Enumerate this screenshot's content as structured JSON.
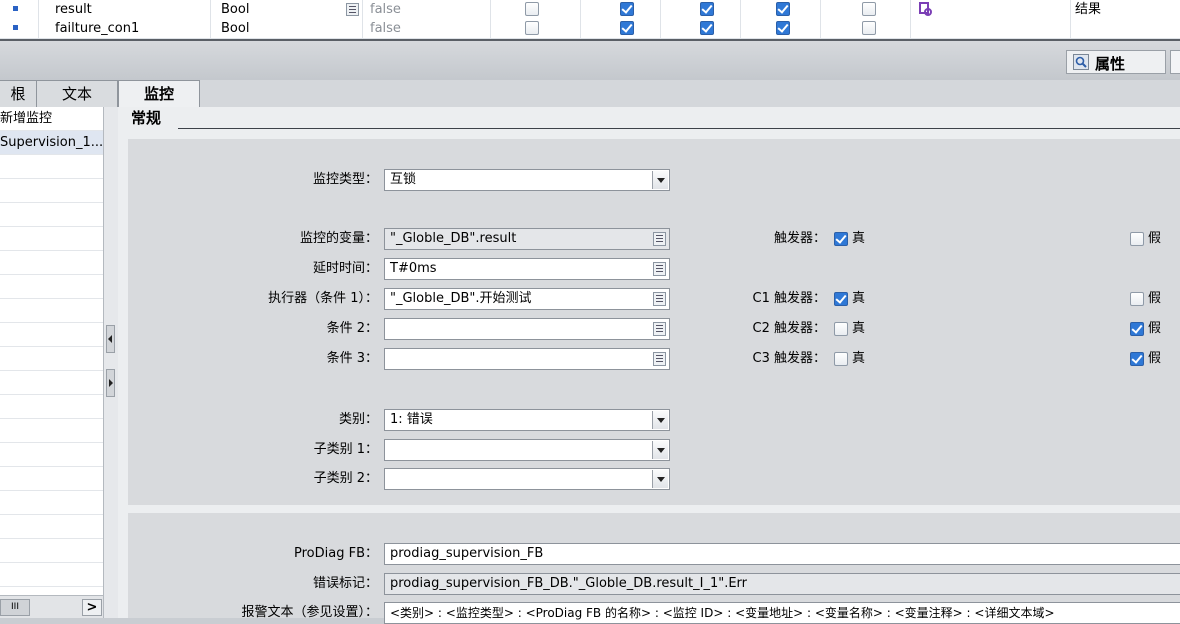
{
  "table": {
    "rows": [
      {
        "name": "result",
        "type": "Bool",
        "value": "false",
        "checks": [
          false,
          true,
          true,
          true,
          false
        ],
        "comment": "结果"
      },
      {
        "name": "failture_con1",
        "type": "Bool",
        "value": "false",
        "checks": [
          false,
          true,
          true,
          true,
          false
        ],
        "comment": ""
      }
    ]
  },
  "header": {
    "properties_label": "属性"
  },
  "tabs": [
    {
      "label": "根"
    },
    {
      "label": "文本"
    },
    {
      "label": "监控"
    }
  ],
  "left_panel": {
    "items": [
      "新增监控",
      "Supervision_1..."
    ]
  },
  "main": {
    "section_title": "常规",
    "supervision_type": {
      "label": "监控类型：",
      "value": "互锁"
    },
    "supervised_tag": {
      "label": "监控的变量：",
      "value": "\"_Globle_DB\".result"
    },
    "delay": {
      "label": "延时时间：",
      "value": "T#0ms"
    },
    "condition1": {
      "label": "执行器（条件 1）：",
      "value": "\"_Globle_DB\".开始测试"
    },
    "condition2": {
      "label": "条件 2：",
      "value": ""
    },
    "condition3": {
      "label": "条件 3：",
      "value": ""
    },
    "triggers": [
      {
        "label": "触发器：",
        "true_label": "真",
        "true_checked": true,
        "false_label": "假",
        "false_checked": false
      },
      {
        "label": "C1 触发器：",
        "true_label": "真",
        "true_checked": true,
        "false_label": "假",
        "false_checked": false
      },
      {
        "label": "C2 触发器：",
        "true_label": "真",
        "true_checked": false,
        "false_label": "假",
        "false_checked": true
      },
      {
        "label": "C3 触发器：",
        "true_label": "真",
        "true_checked": false,
        "false_label": "假",
        "false_checked": true
      }
    ],
    "category": {
      "label": "类别：",
      "value": "1: 错误"
    },
    "subcategory1": {
      "label": "子类别 1：",
      "value": ""
    },
    "subcategory2": {
      "label": "子类别 2：",
      "value": ""
    },
    "prodiag_fb": {
      "label": "ProDiag FB：",
      "value": "prodiag_supervision_FB"
    },
    "error_flag": {
      "label": "错误标记：",
      "value": "prodiag_supervision_FB_DB.\"_Globle_DB.result_I_1\".Err"
    },
    "alarm_text": {
      "label": "报警文本（参见设置）：",
      "value": "<类别> : <监控类型> : <ProDiag FB 的名称> : <监控 ID> : <变量地址> : <变量名称> : <变量注释> : <详细文本域>"
    }
  },
  "scrollbar": {
    "thumb_label": "III",
    "right_label": ">"
  }
}
